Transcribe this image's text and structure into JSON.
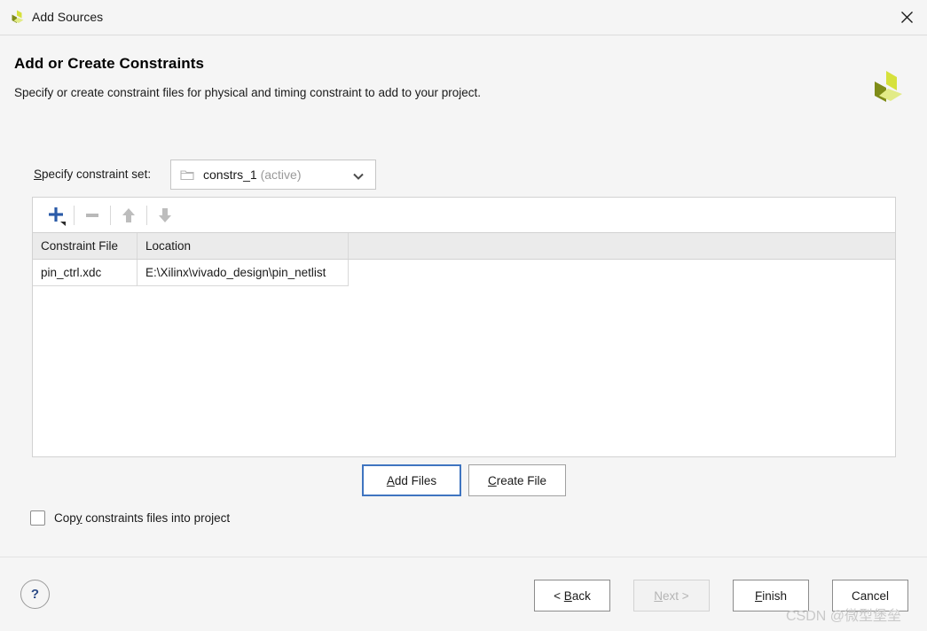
{
  "window": {
    "title": "Add Sources",
    "app_icon": "vivado-logo-icon",
    "close_icon": "close-icon"
  },
  "header": {
    "title": "Add or Create Constraints",
    "subtitle": "Specify or create constraint files for physical and timing constraint to add to your project.",
    "brand_icon": "vivado-logo-icon"
  },
  "constraint_set": {
    "label_mnemonic": "S",
    "label_rest": "pecify constraint set:",
    "folder_icon": "folder-icon",
    "value": "constrs_1",
    "state": "(active)",
    "chevron_icon": "chevron-down-icon",
    "options": [
      "constrs_1 (active)"
    ]
  },
  "toolbar": {
    "buttons": [
      {
        "name": "add-sources-button",
        "icon": "plus-icon",
        "enabled": true
      },
      {
        "name": "remove-sources-button",
        "icon": "minus-icon",
        "enabled": false
      },
      {
        "name": "move-up-button",
        "icon": "arrow-up-icon",
        "enabled": false
      },
      {
        "name": "move-down-button",
        "icon": "arrow-down-icon",
        "enabled": false
      }
    ]
  },
  "table": {
    "columns": [
      "Constraint File",
      "Location"
    ],
    "rows": [
      {
        "constraint_file": "pin_ctrl.xdc",
        "location": "E:\\Xilinx\\vivado_design\\pin_netlist"
      }
    ]
  },
  "panel_actions": {
    "add_files_mnemonic": "A",
    "add_files_rest": "dd Files",
    "create_file_mnemonic": "C",
    "create_file_rest": "reate File"
  },
  "copy_option": {
    "label_before": "Cop",
    "label_mnemonic": "y",
    "label_after": " constraints files into project",
    "checked": false
  },
  "footer": {
    "help_label": "?",
    "back_before": "< ",
    "back_mnemonic": "B",
    "back_rest": "ack",
    "next_mnemonic": "N",
    "next_rest": "ext >",
    "next_enabled": false,
    "finish_mnemonic": "F",
    "finish_rest": "inish",
    "cancel_label": "Cancel"
  },
  "watermark": {
    "text": "CSDN @微型堡垒"
  },
  "colors": {
    "accent_blue": "#3f74c0",
    "logo_olive": "#7f8c18",
    "logo_yellow": "#d6e13c",
    "logo_light": "#e2eb86",
    "header_gray": "#ebebeb"
  }
}
